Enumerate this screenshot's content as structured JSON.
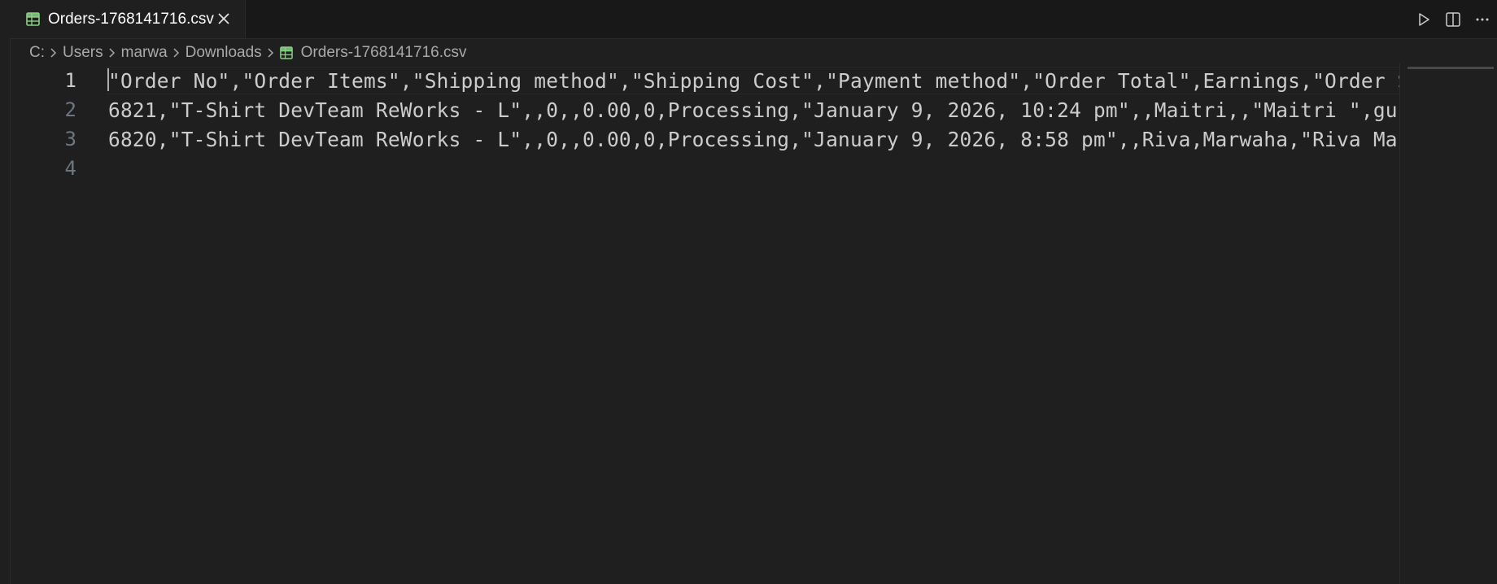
{
  "tab": {
    "label": "Orders-1768141716.csv",
    "close_glyph": "✕",
    "icon": "csv-file-icon",
    "icon_color": "#89d185"
  },
  "actions": {
    "run_icon": "play-icon",
    "split_icon": "split-editor-icon",
    "more_icon": "more-actions-icon",
    "more_glyph": "···"
  },
  "breadcrumb": {
    "segments": [
      "C:",
      "Users",
      "marwa",
      "Downloads"
    ],
    "file": "Orders-1768141716.csv",
    "separator": "›"
  },
  "editor": {
    "lines": [
      {
        "number": "1",
        "text": "\"Order No\",\"Order Items\",\"Shipping method\",\"Shipping Cost\",\"Payment method\",\"Order Total\",Earnings,\"Order S"
      },
      {
        "number": "2",
        "text": "6821,\"T-Shirt DevTeam ReWorks - L\",,0,,0.00,0,Processing,\"January 9, 2026, 10:24 pm\",,Maitri,,\"Maitri \",gup"
      },
      {
        "number": "3",
        "text": "6820,\"T-Shirt DevTeam ReWorks - L\",,0,,0.00,0,Processing,\"January 9, 2026, 8:58 pm\",,Riva,Marwaha,\"Riva Mar"
      },
      {
        "number": "4",
        "text": ""
      }
    ],
    "active_line": "1"
  },
  "colors": {
    "background": "#1f1f1f",
    "tabbar": "#181818",
    "text": "#cccccc",
    "line_number": "#6e7681",
    "file_icon": "#89d185"
  }
}
